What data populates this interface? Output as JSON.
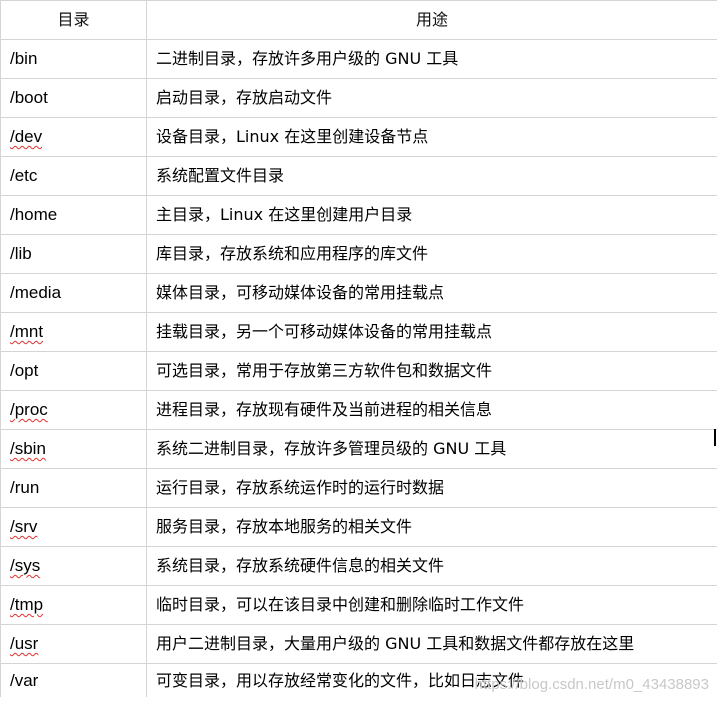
{
  "table": {
    "headers": {
      "path": "目录",
      "desc": "用途"
    },
    "rows": [
      {
        "path": "/bin",
        "desc": "二进制目录，存放许多用户级的 GNU 工具",
        "spell": false
      },
      {
        "path": "/boot",
        "desc": "启动目录，存放启动文件",
        "spell": false
      },
      {
        "path": "/dev",
        "desc": "设备目录，Linux 在这里创建设备节点",
        "spell": true
      },
      {
        "path": "/etc",
        "desc": "系统配置文件目录",
        "spell": false
      },
      {
        "path": "/home",
        "desc": "主目录，Linux 在这里创建用户目录",
        "spell": false
      },
      {
        "path": "/lib",
        "desc": "库目录，存放系统和应用程序的库文件",
        "spell": false
      },
      {
        "path": "/media",
        "desc": "媒体目录，可移动媒体设备的常用挂载点",
        "spell": false
      },
      {
        "path": "/mnt",
        "desc": "挂载目录，另一个可移动媒体设备的常用挂载点",
        "spell": true
      },
      {
        "path": "/opt",
        "desc": "可选目录，常用于存放第三方软件包和数据文件",
        "spell": false
      },
      {
        "path": "/proc",
        "desc": "进程目录，存放现有硬件及当前进程的相关信息",
        "spell": true
      },
      {
        "path": "/sbin",
        "desc": "系统二进制目录，存放许多管理员级的 GNU 工具",
        "spell": true
      },
      {
        "path": "/run",
        "desc": "运行目录，存放系统运作时的运行时数据",
        "spell": false
      },
      {
        "path": "/srv",
        "desc": "服务目录，存放本地服务的相关文件",
        "spell": true
      },
      {
        "path": "/sys",
        "desc": "系统目录，存放系统硬件信息的相关文件",
        "spell": true
      },
      {
        "path": "/tmp",
        "desc": "临时目录，可以在该目录中创建和删除临时工作文件",
        "spell": true
      },
      {
        "path": "/usr",
        "desc": "用户二进制目录，大量用户级的 GNU 工具和数据文件都存放在这里",
        "spell": true
      },
      {
        "path": "/var",
        "desc": "可变目录，用以存放经常变化的文件，比如日志文件",
        "spell": false
      }
    ]
  },
  "watermark": "https://blog.csdn.net/m0_43438893",
  "colors": {
    "border": "#d4d4d4",
    "spellcheck": "#e03030",
    "watermark": "#c8c8c8"
  }
}
